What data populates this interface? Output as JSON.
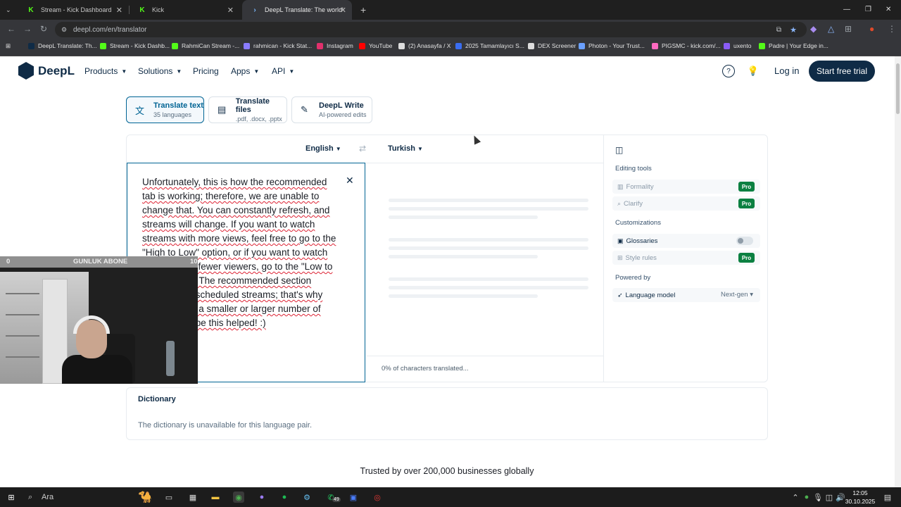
{
  "browser": {
    "tabs": [
      {
        "title": "Stream - Kick Dashboard"
      },
      {
        "title": "Kick"
      },
      {
        "title": "DeepL Translate: The world's m"
      }
    ],
    "url": "deepl.com/en/translator",
    "bookmarks": [
      {
        "label": "DeepL Translate: Th..."
      },
      {
        "label": "Stream - Kick Dashb..."
      },
      {
        "label": "RahmiCan Stream -..."
      },
      {
        "label": "rahmican - Kick Stat..."
      },
      {
        "label": "Instagram"
      },
      {
        "label": "YouTube"
      },
      {
        "label": "(2) Anasayfa / X"
      },
      {
        "label": "2025 Tamamlayıcı S..."
      },
      {
        "label": "DEX Screener"
      },
      {
        "label": "Photon - Your Trust..."
      },
      {
        "label": "PIGSMC - kick.com/..."
      },
      {
        "label": "uxento"
      },
      {
        "label": "Padre | Your Edge in..."
      }
    ]
  },
  "site": {
    "logo": "DeepL",
    "nav": {
      "products": "Products",
      "solutions": "Solutions",
      "pricing": "Pricing",
      "apps": "Apps",
      "api": "API"
    },
    "login": "Log in",
    "trial": "Start free trial"
  },
  "modes": [
    {
      "title": "Translate text",
      "sub": "35 languages"
    },
    {
      "title": "Translate files",
      "sub": ".pdf, .docx, .pptx"
    },
    {
      "title": "DeepL Write",
      "sub": "AI-powered edits"
    }
  ],
  "translator": {
    "source_lang": "English",
    "target_lang": "Turkish",
    "source_text_lines": [
      "Unfortunately, this is how the recommended",
      "tab is working; therefore, we are unable to",
      "change that. You can constantly refresh, and",
      "streams will change. If you want to watch",
      "streams with more views, feel free to go to the",
      "\"High to Low\" option, or if you want to watch",
      "streams with fewer viewers, go to the \"Low to",
      "High\" option. The recommended section",
      "may include scheduled streams; that's why",
      "you may see a smaller or larger number of",
      "viewers. I hope this helped! :)"
    ],
    "progress": "0% of characters translated..."
  },
  "sidebar": {
    "editing_tools": "Editing tools",
    "formality": "Formality",
    "clarify": "Clarify",
    "pro": "Pro",
    "customizations": "Customizations",
    "glossaries": "Glossaries",
    "style_rules": "Style rules",
    "powered_by": "Powered by",
    "language_model": "Language model",
    "model_value": "Next-gen"
  },
  "dictionary": {
    "title": "Dictionary",
    "text": "The dictionary is unavailable for this language pair."
  },
  "trusted": "Trusted by over 200,000 businesses globally",
  "overlay": {
    "left": "0",
    "label": "GUNLUK ABONE",
    "right": "10"
  },
  "taskbar": {
    "search": "Ara",
    "time": "12:05",
    "date": "30.10.2025",
    "badge": "49"
  }
}
